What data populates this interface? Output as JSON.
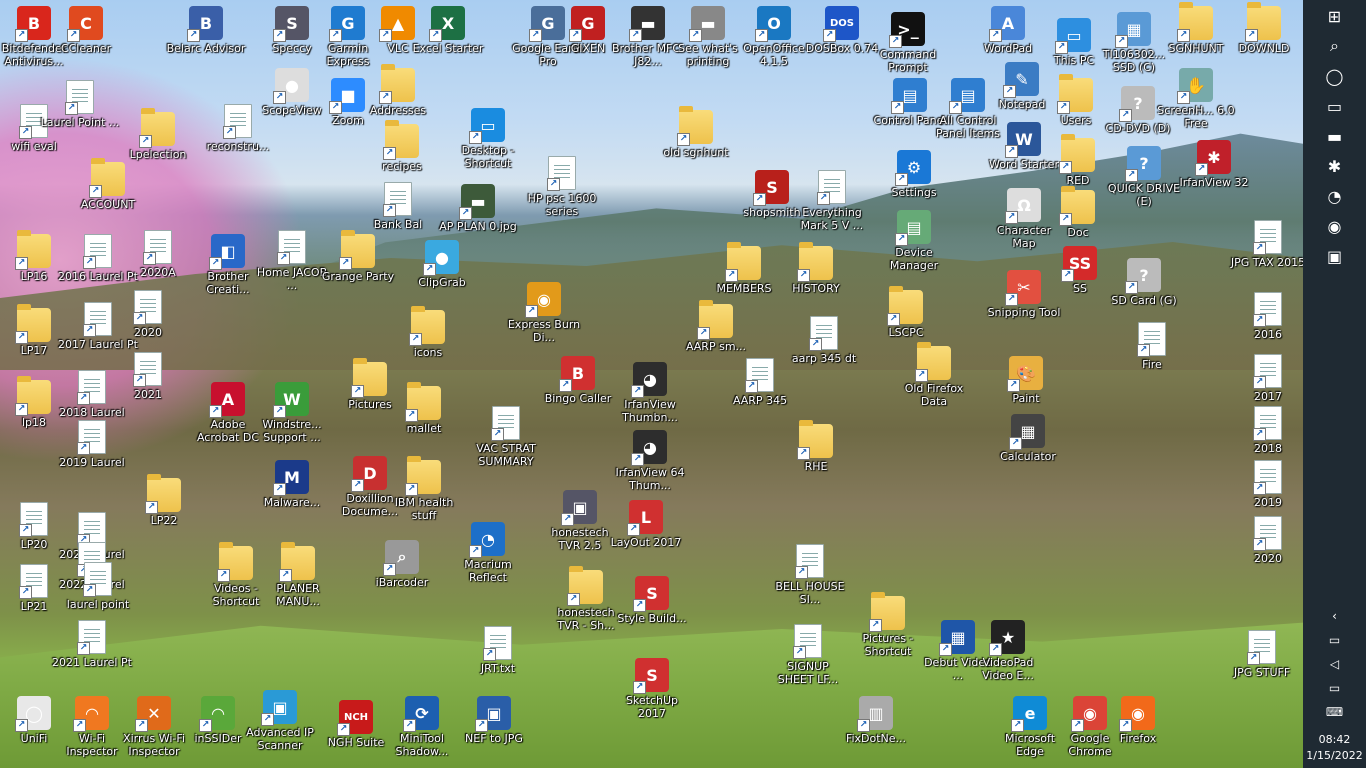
{
  "icons": [
    {
      "label": "Bitdefender Antivirus...",
      "icon": "bitdefender-icon",
      "color": "#d9261c",
      "txt": "B"
    },
    {
      "label": "CCleaner",
      "icon": "ccleaner-icon",
      "color": "#e04a1f",
      "txt": "C"
    },
    {
      "label": "Belarc Advisor",
      "icon": "belarc-icon",
      "color": "#3a5fa8",
      "txt": "B"
    },
    {
      "label": "Speccy",
      "icon": "speccy-icon",
      "color": "#556",
      "txt": "S"
    },
    {
      "label": "Garmin Express",
      "icon": "garmin-icon",
      "color": "#1f7bd0",
      "txt": "G"
    },
    {
      "label": "VLC",
      "icon": "vlc-icon",
      "color": "#f08a00",
      "txt": "▲"
    },
    {
      "label": "Excel Starter",
      "icon": "excel-icon",
      "color": "#1d7044",
      "txt": "X"
    },
    {
      "label": "Google Earth Pro",
      "icon": "google-earth-icon",
      "color": "#4a6e9a",
      "txt": "G"
    },
    {
      "label": "GIXEN",
      "icon": "gixen-icon",
      "color": "#c02020",
      "txt": "G"
    },
    {
      "label": "Brother MFC-J82...",
      "icon": "printer-icon",
      "color": "#333",
      "txt": "▬"
    },
    {
      "label": "See what's printing",
      "icon": "printer-queue-icon",
      "color": "#888",
      "txt": "▬"
    },
    {
      "label": "OpenOffice 4.1.5",
      "icon": "openoffice-icon",
      "color": "#1a78c2",
      "txt": "O"
    },
    {
      "label": "DOSBox 0.74",
      "icon": "dosbox-icon",
      "color": "#1e56c8",
      "txt": "DOS"
    },
    {
      "label": "Command Prompt",
      "icon": "cmd-icon",
      "color": "#111",
      "txt": ">_"
    },
    {
      "label": "WordPad",
      "icon": "wordpad-icon",
      "color": "#4a87d9",
      "txt": "A"
    },
    {
      "label": "This PC",
      "icon": "this-pc-icon",
      "color": "#2d8fe0",
      "txt": "▭"
    },
    {
      "label": "TI106302... SSD (C)",
      "icon": "drive-icon",
      "color": "#5a9ad6",
      "txt": "▦"
    },
    {
      "label": "SGNHUNT",
      "icon": "folder-icon",
      "color": "folder",
      "txt": ""
    },
    {
      "label": "DOWNLD",
      "icon": "download-folder-icon",
      "color": "folder",
      "txt": ""
    },
    {
      "label": "ScopeView",
      "icon": "webcam-icon",
      "color": "#ddd",
      "txt": "●"
    },
    {
      "label": "Zoom",
      "icon": "zoom-icon",
      "color": "#2d8cff",
      "txt": "■"
    },
    {
      "label": "Addresses",
      "icon": "folder-icon",
      "color": "folder",
      "txt": ""
    },
    {
      "label": "Desktop - Shortcut",
      "icon": "desktop-shortcut-icon",
      "color": "#1a8ce0",
      "txt": "▭"
    },
    {
      "label": "HP psc 1600 series",
      "icon": "file-icon",
      "color": "doc",
      "txt": ""
    },
    {
      "label": "old sgnhunt",
      "icon": "folder-icon",
      "color": "folder",
      "txt": ""
    },
    {
      "label": "shopsmith",
      "icon": "shopsmith-icon",
      "color": "#b8201b",
      "txt": "S"
    },
    {
      "label": "Everything Mark 5 V ...",
      "icon": "file-icon",
      "color": "doc",
      "txt": ""
    },
    {
      "label": "Control Panel",
      "icon": "control-panel-icon",
      "color": "#2f7ed0",
      "txt": "▤"
    },
    {
      "label": "All Control Panel Items",
      "icon": "control-panel-icon",
      "color": "#2f7ed0",
      "txt": "▤"
    },
    {
      "label": "Notepad",
      "icon": "notepad-icon",
      "color": "#3b7cc4",
      "txt": "✎"
    },
    {
      "label": "Users",
      "icon": "folder-icon",
      "color": "folder",
      "txt": ""
    },
    {
      "label": "CD-DVD (D)",
      "icon": "cd-drive-icon",
      "color": "#bbb",
      "txt": "?"
    },
    {
      "label": "ScreenH... 6.0 Free",
      "icon": "screenhunter-icon",
      "color": "#7aa",
      "txt": "✋"
    },
    {
      "label": "wifi eval",
      "icon": "file-icon",
      "color": "doc",
      "txt": ""
    },
    {
      "label": "Laurel Point ...",
      "icon": "file-icon",
      "color": "doc",
      "txt": ""
    },
    {
      "label": "Lpelection",
      "icon": "folder-icon",
      "color": "folder",
      "txt": ""
    },
    {
      "label": "reconstru...",
      "icon": "file-icon",
      "color": "doc",
      "txt": ""
    },
    {
      "label": "recipes",
      "icon": "folder-icon",
      "color": "folder",
      "txt": ""
    },
    {
      "label": "Word Starter",
      "icon": "word-icon",
      "color": "#2b579a",
      "txt": "W"
    },
    {
      "label": "RED",
      "icon": "folder-icon",
      "color": "folder",
      "txt": ""
    },
    {
      "label": "QUICK DRIVE (E)",
      "icon": "drive-icon",
      "color": "#5a9ad6",
      "txt": "?"
    },
    {
      "label": "IrfanView 32",
      "icon": "irfanview-icon",
      "color": "#c0202a",
      "txt": "✱"
    },
    {
      "label": "ACCOUNT",
      "icon": "folder-icon",
      "color": "folder",
      "txt": ""
    },
    {
      "label": "Bank Bal",
      "icon": "file-icon",
      "color": "doc",
      "txt": ""
    },
    {
      "label": "AP PLAN 0.jpg",
      "icon": "image-icon",
      "color": "#3d5a3a",
      "txt": "▬"
    },
    {
      "label": "Settings",
      "icon": "settings-icon",
      "color": "#1a78d6",
      "txt": "⚙"
    },
    {
      "label": "Character Map",
      "icon": "charmap-icon",
      "color": "#ddd",
      "txt": "Ω"
    },
    {
      "label": "Doc",
      "icon": "folder-icon",
      "color": "folder",
      "txt": ""
    },
    {
      "label": "LP16",
      "icon": "folder-icon",
      "color": "folder",
      "txt": ""
    },
    {
      "label": "2016 Laurel Pt",
      "icon": "file-icon",
      "color": "doc",
      "txt": ""
    },
    {
      "label": "2020A",
      "icon": "file-icon",
      "color": "doc",
      "txt": ""
    },
    {
      "label": "Brother Creati...",
      "icon": "brother-icon",
      "color": "#2968c8",
      "txt": "◧"
    },
    {
      "label": "Home JACOB ...",
      "icon": "file-icon",
      "color": "doc",
      "txt": ""
    },
    {
      "label": "Grange Party",
      "icon": "folder-icon",
      "color": "folder",
      "txt": ""
    },
    {
      "label": "ClipGrab",
      "icon": "clipgrab-icon",
      "color": "#3aa9e0",
      "txt": "●"
    },
    {
      "label": "MEMBERS",
      "icon": "folder-icon",
      "color": "folder",
      "txt": ""
    },
    {
      "label": "HISTORY",
      "icon": "folder-icon",
      "color": "folder",
      "txt": ""
    },
    {
      "label": "Device Manager",
      "icon": "device-manager-icon",
      "color": "#6a7",
      "txt": "▤"
    },
    {
      "label": "SS",
      "icon": "ss-icon",
      "color": "#d42a2a",
      "txt": "SS"
    },
    {
      "label": "SD Card (G)",
      "icon": "sd-card-icon",
      "color": "#bbb",
      "txt": "?"
    },
    {
      "label": "JPG TAX 2015",
      "icon": "file-icon",
      "color": "doc",
      "txt": ""
    },
    {
      "label": "LP17",
      "icon": "folder-icon",
      "color": "folder",
      "txt": ""
    },
    {
      "label": "2017 Laurel Pt",
      "icon": "file-icon",
      "color": "doc",
      "txt": ""
    },
    {
      "label": "2020",
      "icon": "file-icon",
      "color": "doc",
      "txt": ""
    },
    {
      "label": "Express Burn Di...",
      "icon": "express-burn-icon",
      "color": "#e29a1a",
      "txt": "◉"
    },
    {
      "label": "icons",
      "icon": "folder-icon",
      "color": "folder",
      "txt": ""
    },
    {
      "label": "AARP sm...",
      "icon": "folder-icon",
      "color": "folder",
      "txt": ""
    },
    {
      "label": "aarp 345 dt",
      "icon": "file-icon",
      "color": "doc",
      "txt": ""
    },
    {
      "label": "LSCPC",
      "icon": "folder-icon",
      "color": "folder",
      "txt": ""
    },
    {
      "label": "Snipping Tool",
      "icon": "snipping-tool-icon",
      "color": "#e25040",
      "txt": "✂"
    },
    {
      "label": "2016",
      "icon": "file-icon",
      "color": "doc",
      "txt": ""
    },
    {
      "label": "Fire",
      "icon": "file-icon",
      "color": "doc",
      "txt": ""
    },
    {
      "label": "lp18",
      "icon": "folder-icon",
      "color": "folder",
      "txt": ""
    },
    {
      "label": "2018 Laurel",
      "icon": "file-icon",
      "color": "doc",
      "txt": ""
    },
    {
      "label": "2021",
      "icon": "file-icon",
      "color": "doc",
      "txt": ""
    },
    {
      "label": "Adobe Acrobat DC",
      "icon": "acrobat-icon",
      "color": "#c8102e",
      "txt": "A"
    },
    {
      "label": "Windstre... Support ...",
      "icon": "windstream-icon",
      "color": "#3a9c3a",
      "txt": "W"
    },
    {
      "label": "Pictures",
      "icon": "folder-icon",
      "color": "folder",
      "txt": ""
    },
    {
      "label": "mallet",
      "icon": "folder-icon",
      "color": "folder",
      "txt": ""
    },
    {
      "label": "Bingo Caller",
      "icon": "bingo-icon",
      "color": "#d03030",
      "txt": "B"
    },
    {
      "label": "IrfanView Thumbn...",
      "icon": "irfanview-thumbs-icon",
      "color": "#2d2d2d",
      "txt": "◕"
    },
    {
      "label": "AARP 345",
      "icon": "file-icon",
      "color": "doc",
      "txt": ""
    },
    {
      "label": "Old Firefox Data",
      "icon": "folder-icon",
      "color": "folder",
      "txt": ""
    },
    {
      "label": "Paint",
      "icon": "paint-icon",
      "color": "#e8b040",
      "txt": "🎨"
    },
    {
      "label": "2017",
      "icon": "file-icon",
      "color": "doc",
      "txt": ""
    },
    {
      "label": "2019 Laurel",
      "icon": "file-icon",
      "color": "doc",
      "txt": ""
    },
    {
      "label": "VAC STRAT SUMMARY",
      "icon": "file-icon",
      "color": "doc",
      "txt": ""
    },
    {
      "label": "IrfanView 64 Thum...",
      "icon": "irfanview-thumbs-icon",
      "color": "#2d2d2d",
      "txt": "◕"
    },
    {
      "label": "RHE",
      "icon": "folder-icon",
      "color": "folder",
      "txt": ""
    },
    {
      "label": "Calculator",
      "icon": "calculator-icon",
      "color": "#444",
      "txt": "▦"
    },
    {
      "label": "2018",
      "icon": "file-icon",
      "color": "doc",
      "txt": ""
    },
    {
      "label": "Malware...",
      "icon": "malwarebytes-icon",
      "color": "#1b3a8a",
      "txt": "M"
    },
    {
      "label": "Doxillion Docume...",
      "icon": "doxillion-icon",
      "color": "#c83030",
      "txt": "D"
    },
    {
      "label": "IBM health stuff",
      "icon": "folder-icon",
      "color": "folder",
      "txt": ""
    },
    {
      "label": "2019",
      "icon": "file-icon",
      "color": "doc",
      "txt": ""
    },
    {
      "label": "LP20",
      "icon": "file-icon",
      "color": "doc",
      "txt": ""
    },
    {
      "label": "2021 Laurel",
      "icon": "file-icon",
      "color": "doc",
      "txt": ""
    },
    {
      "label": "LP22",
      "icon": "folder-icon",
      "color": "folder",
      "txt": ""
    },
    {
      "label": "Macrium Reflect",
      "icon": "macrium-icon",
      "color": "#1d6fc8",
      "txt": "◔"
    },
    {
      "label": "honestech TVR 2.5",
      "icon": "honestech-icon",
      "color": "#556",
      "txt": "▣"
    },
    {
      "label": "LayOut 2017",
      "icon": "layout-icon",
      "color": "#d03030",
      "txt": "L"
    },
    {
      "label": "2020",
      "icon": "file-icon",
      "color": "doc",
      "txt": ""
    },
    {
      "label": "2022 Laurel",
      "icon": "file-icon",
      "color": "doc",
      "txt": ""
    },
    {
      "label": "Videos - Shortcut",
      "icon": "folder-icon",
      "color": "folder",
      "txt": ""
    },
    {
      "label": "PLANER MANU...",
      "icon": "folder-icon",
      "color": "folder",
      "txt": ""
    },
    {
      "label": "iBarcoder",
      "icon": "ibarcoder-icon",
      "color": "#999",
      "txt": "⌕"
    },
    {
      "label": "BELL HOUSE SI...",
      "icon": "file-icon",
      "color": "doc",
      "txt": ""
    },
    {
      "label": "LP21",
      "icon": "file-icon",
      "color": "doc",
      "txt": ""
    },
    {
      "label": "laurel point",
      "icon": "file-icon",
      "color": "doc",
      "txt": ""
    },
    {
      "label": "honestech TVR - Sh...",
      "icon": "folder-icon",
      "color": "folder",
      "txt": ""
    },
    {
      "label": "Style Build...",
      "icon": "style-builder-icon",
      "color": "#d03030",
      "txt": "S"
    },
    {
      "label": "Pictures - Shortcut",
      "icon": "folder-icon",
      "color": "folder",
      "txt": ""
    },
    {
      "label": "Debut Video ...",
      "icon": "debut-icon",
      "color": "#1f56a8",
      "txt": "▦"
    },
    {
      "label": "VideoPad Video E...",
      "icon": "videopad-icon",
      "color": "#222",
      "txt": "★"
    },
    {
      "label": "JPG STUFF",
      "icon": "file-icon",
      "color": "doc",
      "txt": ""
    },
    {
      "label": "2021 Laurel Pt",
      "icon": "file-icon",
      "color": "doc",
      "txt": ""
    },
    {
      "label": "JRT.txt",
      "icon": "file-icon",
      "color": "doc",
      "txt": ""
    },
    {
      "label": "SIGNUP SHEET LF...",
      "icon": "file-icon",
      "color": "doc",
      "txt": ""
    },
    {
      "label": "SketchUp 2017",
      "icon": "sketchup-icon",
      "color": "#d03030",
      "txt": "S"
    },
    {
      "label": "UniFi",
      "icon": "unifi-icon",
      "color": "#e8e8e8",
      "txt": "◯"
    },
    {
      "label": "Wi-Fi Inspector",
      "icon": "wifi-inspector-icon",
      "color": "#f07820",
      "txt": "◠"
    },
    {
      "label": "Xirrus Wi-Fi Inspector",
      "icon": "xirrus-icon",
      "color": "#e06a1a",
      "txt": "✕"
    },
    {
      "label": "inSSIDer",
      "icon": "inssider-icon",
      "color": "#5aa83a",
      "txt": "◠"
    },
    {
      "label": "Advanced IP Scanner",
      "icon": "ip-scanner-icon",
      "color": "#2a9ad6",
      "txt": "▣"
    },
    {
      "label": "NGH Suite",
      "icon": "nch-icon",
      "color": "#c81a1a",
      "txt": "NCH"
    },
    {
      "label": "MiniTool Shadow...",
      "icon": "minitool-icon",
      "color": "#1d5fb0",
      "txt": "⟳"
    },
    {
      "label": "NEF to JPG",
      "icon": "nef-to-jpg-icon",
      "color": "#2a5ea8",
      "txt": "▣"
    },
    {
      "label": "FixDotNe...",
      "icon": "fixdotnet-icon",
      "color": "#aaa",
      "txt": "▥"
    },
    {
      "label": "Microsoft Edge",
      "icon": "edge-icon",
      "color": "#0f8bd6",
      "txt": "e"
    },
    {
      "label": "Google Chrome",
      "icon": "chrome-icon",
      "color": "#db4437",
      "txt": "◉"
    },
    {
      "label": "Firefox",
      "icon": "firefox-icon",
      "color": "#f2691a",
      "txt": "◉"
    }
  ],
  "taskbar": {
    "items": [
      {
        "icon": "windows-start-icon",
        "glyph": "⊞"
      },
      {
        "icon": "search-icon",
        "glyph": "⌕"
      },
      {
        "icon": "cortana-icon",
        "glyph": "◯"
      },
      {
        "icon": "task-view-icon",
        "glyph": "▭"
      },
      {
        "icon": "file-explorer-icon",
        "glyph": "▬"
      },
      {
        "icon": "pinned-app-icon",
        "glyph": "✱"
      },
      {
        "icon": "speedometer-icon",
        "glyph": "◔"
      },
      {
        "icon": "firefox-taskbar-icon",
        "glyph": "◉"
      },
      {
        "icon": "pinned-app-2-icon",
        "glyph": "▣"
      }
    ],
    "tray": [
      {
        "icon": "chevron-up-icon",
        "glyph": "‹"
      },
      {
        "icon": "network-icon",
        "glyph": "▭"
      },
      {
        "icon": "volume-icon",
        "glyph": "◁"
      },
      {
        "icon": "display-icon",
        "glyph": "▭"
      },
      {
        "icon": "keyboard-icon",
        "glyph": "⌨"
      }
    ],
    "time": "08:42",
    "date": "1/15/2022"
  }
}
